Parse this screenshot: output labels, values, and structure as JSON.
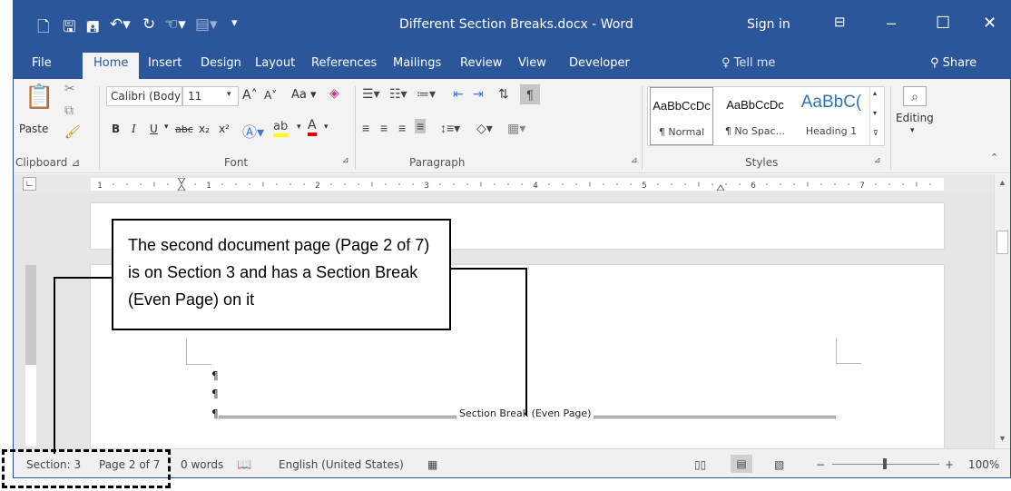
{
  "titlebar": {
    "document_title": "Different Section Breaks.docx - Word",
    "sign_in": "Sign in",
    "qat_icons": [
      "new-icon",
      "save-icon",
      "save-as-icon",
      "undo-icon",
      "redo-icon",
      "touch-mode-icon",
      "customize-icon"
    ],
    "window_icons": [
      "ribbon-display-icon",
      "minimize-icon",
      "maximize-icon",
      "close-icon"
    ]
  },
  "tabs": [
    "File",
    "Home",
    "Insert",
    "Design",
    "Layout",
    "References",
    "Mailings",
    "Review",
    "View",
    "Developer"
  ],
  "active_tab": "Home",
  "tell_me": "Tell me",
  "share": "Share",
  "ribbon": {
    "clipboard": {
      "paste_label": "Paste",
      "group_label": "Clipboard"
    },
    "font": {
      "font_name": "Calibri (Body",
      "font_size": "11",
      "case_label": "Aa",
      "bold": "B",
      "italic": "I",
      "underline": "U",
      "strike": "abc",
      "subscript": "x₂",
      "superscript": "x²",
      "group_label": "Font"
    },
    "paragraph": {
      "group_label": "Paragraph"
    },
    "styles": {
      "items": [
        {
          "sample": "AaBbCcDc",
          "name": "¶ Normal"
        },
        {
          "sample": "AaBbCcDc",
          "name": "¶ No Spac..."
        },
        {
          "sample": "AaBbC(",
          "name": "Heading 1"
        }
      ],
      "group_label": "Styles"
    },
    "editing": {
      "label": "Editing"
    }
  },
  "ruler": {
    "numbers": [
      "1",
      "1",
      "2",
      "3",
      "4",
      "5",
      "6",
      "7"
    ]
  },
  "document": {
    "pilcrow": "¶",
    "section_break_label": "Section Break (Even Page)"
  },
  "statusbar": {
    "section": "Section: 3",
    "page": "Page 2 of 7",
    "words": "0 words",
    "language": "English (United States)",
    "zoom": "100%"
  },
  "annotation": {
    "callout": "The second document page (Page 2 of 7) is on Section 3 and has a Section Break (Even Page) on it"
  },
  "colors": {
    "word_blue": "#2b579a",
    "ribbon_bg": "#f3f3f3",
    "doc_bg": "#e6e6e6"
  }
}
